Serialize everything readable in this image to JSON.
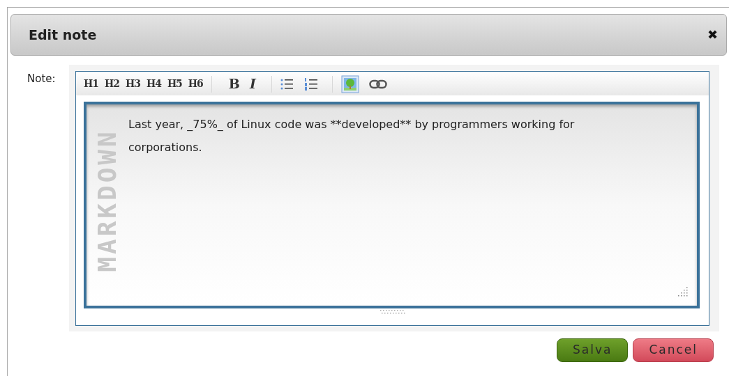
{
  "dialog": {
    "title": "Edit note",
    "close": "✖"
  },
  "field": {
    "label": "Note:"
  },
  "toolbar": {
    "headings": [
      "H1",
      "H2",
      "H3",
      "H4",
      "H5",
      "H6"
    ],
    "bold": "B",
    "italic": "I"
  },
  "editor": {
    "logo": "MARKDOWN",
    "value": "Last year, _75%_ of Linux code was **developed** by programmers working for corporations."
  },
  "buttons": [
    {
      "kind": "save",
      "label": "Salva"
    },
    {
      "kind": "cancel",
      "label": "Cancel"
    }
  ]
}
